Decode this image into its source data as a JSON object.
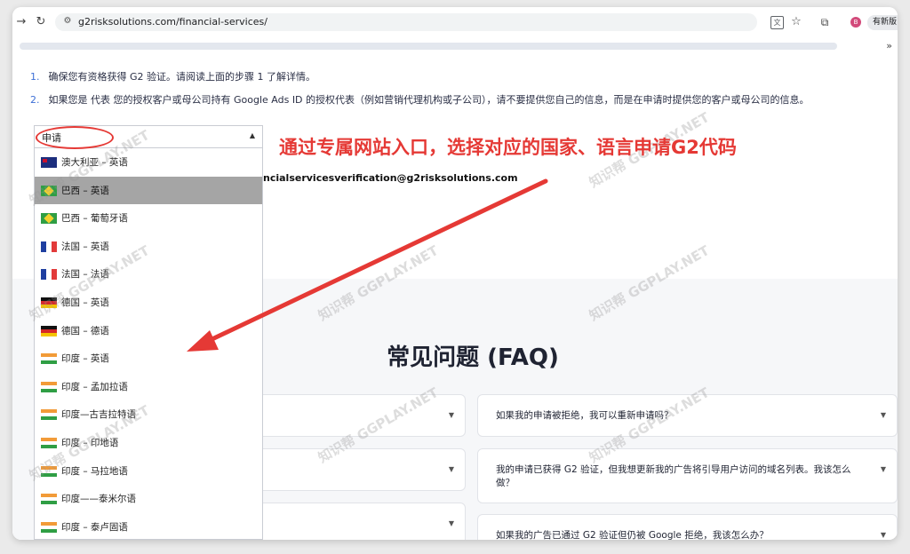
{
  "browser": {
    "url": "g2risksolutions.com/financial-services/",
    "newtab_label": "有新版",
    "profile_initial": "B",
    "more_label": "»"
  },
  "steps": [
    {
      "num": "1.",
      "text": "确保您有资格获得 G2 验证。请阅读上面的步骤 1 了解详情。"
    },
    {
      "num": "2.",
      "text": "如果您是 代表 您的授权客户或母公司持有 Google Ads ID 的授权代表（例如营销代理机构或子公司），请不要提供您自己的信息，而是在申请时提供您的客户或母公司的信息。"
    }
  ],
  "email_text": "ncialservicesverification@g2risksolutions.com",
  "dropdown": {
    "selected_label": "申请",
    "items": [
      {
        "flag": "au",
        "label": "澳大利亚 – 英语",
        "selected": false
      },
      {
        "flag": "br",
        "label": "巴西 – 英语",
        "selected": true
      },
      {
        "flag": "br",
        "label": "巴西 – 葡萄牙语",
        "selected": false
      },
      {
        "flag": "fr",
        "label": "法国 – 英语",
        "selected": false
      },
      {
        "flag": "fr",
        "label": "法国 – 法语",
        "selected": false
      },
      {
        "flag": "de",
        "label": "德国 – 英语",
        "selected": false
      },
      {
        "flag": "de",
        "label": "德国 – 德语",
        "selected": false
      },
      {
        "flag": "in",
        "label": "印度 – 英语",
        "selected": false
      },
      {
        "flag": "in",
        "label": "印度 – 孟加拉语",
        "selected": false
      },
      {
        "flag": "in",
        "label": "印度—古吉拉特语",
        "selected": false
      },
      {
        "flag": "in",
        "label": "印度 – 印地语",
        "selected": false
      },
      {
        "flag": "in",
        "label": "印度 – 马拉地语",
        "selected": false
      },
      {
        "flag": "in",
        "label": "印度——泰米尔语",
        "selected": false
      },
      {
        "flag": "in",
        "label": "印度 – 泰卢固语",
        "selected": false
      }
    ]
  },
  "annotation": {
    "text": "通过专属网站入口，选择对应的国家、语言申请G2代码",
    "color": "#e53935"
  },
  "faq": {
    "title": "常见问题 (FAQ)",
    "right": [
      "如果我的申请被拒绝，我可以重新申请吗？",
      "我的申请已获得 G2 验证，但我想更新我的广告将引导用户访问的域名列表。我该怎么做？",
      "如果我的广告已通过 G2 验证但仍被 Google 拒绝，我该怎么办？"
    ]
  },
  "watermark": "知识帮 GGPLAY.NET"
}
